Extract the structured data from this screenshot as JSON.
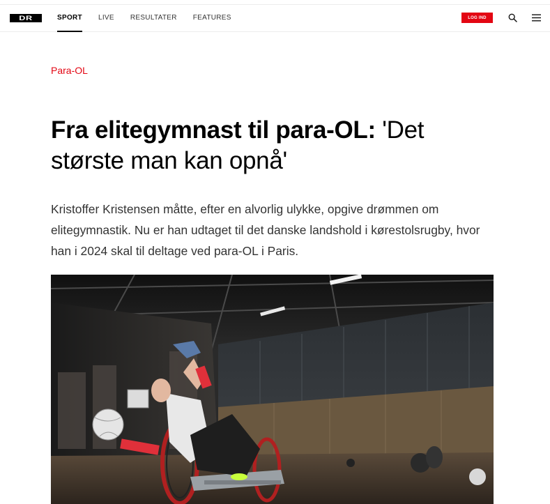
{
  "header": {
    "logo_text": "DR",
    "nav": [
      {
        "label": "SPORT",
        "active": true
      },
      {
        "label": "LIVE",
        "active": false
      },
      {
        "label": "RESULTATER",
        "active": false
      },
      {
        "label": "FEATURES",
        "active": false
      }
    ],
    "login_label": "LOG IND",
    "brand_color": "#e30613"
  },
  "article": {
    "category": "Para-OL",
    "headline_lead": "Fra elitegymnast til para-OL:",
    "headline_rest": " 'Det største man kan opnå'",
    "summary": "Kristoffer Kristensen måtte, efter en alvorlig ulykke, opgive drømmen om elitegymnastik. Nu er han udtaget til det danske landshold i kørestolsrugby, hvor han i 2024 skal til deltage ved para-OL i Paris."
  }
}
